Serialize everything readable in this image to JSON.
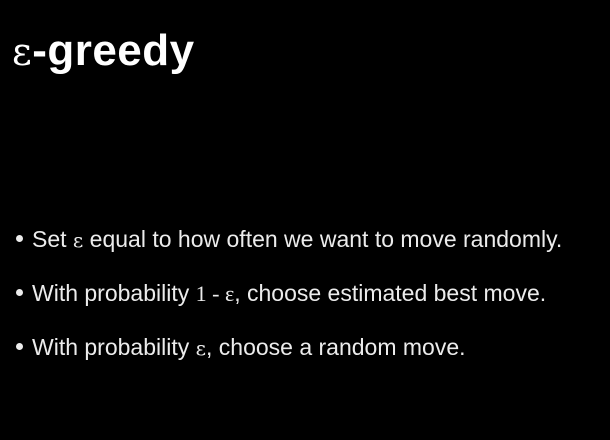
{
  "title": {
    "symbol": "ε",
    "text": "-greedy"
  },
  "bullets": [
    {
      "pre": "Set ",
      "symbol": "ε",
      "post": " equal to how often we want to move randomly."
    },
    {
      "pre": "With probability ",
      "formula": "1 - ε",
      "post": ", choose estimated best move."
    },
    {
      "pre": "With probability ",
      "symbol": "ε",
      "post": ", choose a random move."
    }
  ]
}
